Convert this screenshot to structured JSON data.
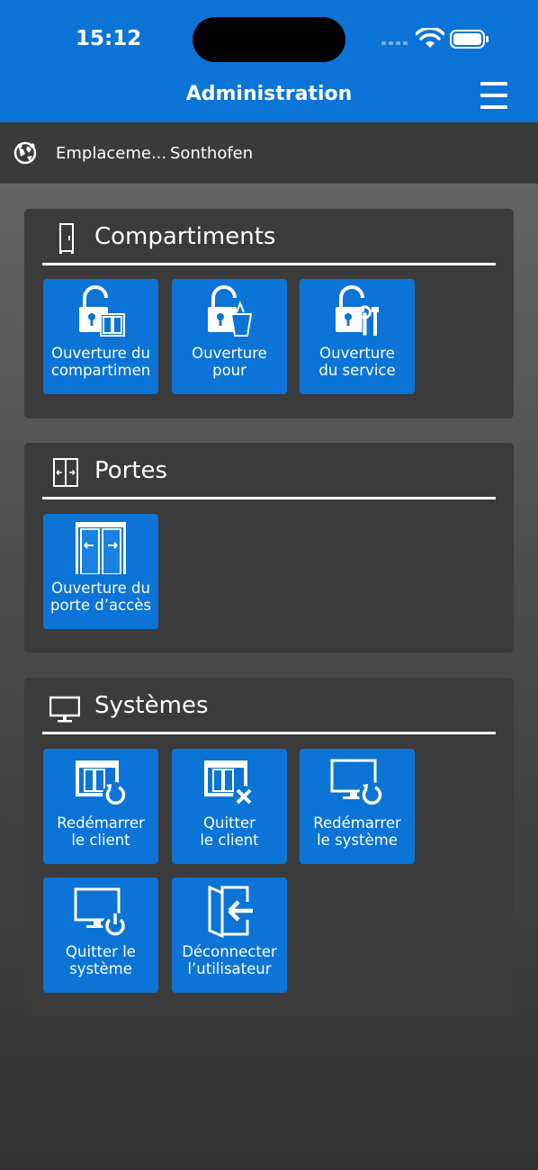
{
  "status": {
    "time": "15:12"
  },
  "header": {
    "title": "Administration"
  },
  "location": {
    "label": "Emplaceme...",
    "value": "Sonthofen"
  },
  "sections": [
    {
      "title": "Compartiments",
      "tiles": [
        {
          "line1": "Ouverture du",
          "line2": "compartimen"
        },
        {
          "line1": "Ouverture",
          "line2": "pour"
        },
        {
          "line1": "Ouverture",
          "line2": "du service"
        }
      ]
    },
    {
      "title": "Portes",
      "tiles": [
        {
          "line1": "Ouverture du",
          "line2": "porte d’accès"
        }
      ]
    },
    {
      "title": "Systèmes",
      "tiles": [
        {
          "line1": "Redémarrer",
          "line2": "le client"
        },
        {
          "line1": "Quitter",
          "line2": "le client"
        },
        {
          "line1": "Redémarrer",
          "line2": "le système"
        },
        {
          "line1": "Quitter le",
          "line2": "système"
        },
        {
          "line1": "Déconnecter",
          "line2": "l’utilisateur"
        }
      ]
    }
  ],
  "colors": {
    "primary": "#0b74d6",
    "panel": "#3b3b3b"
  }
}
